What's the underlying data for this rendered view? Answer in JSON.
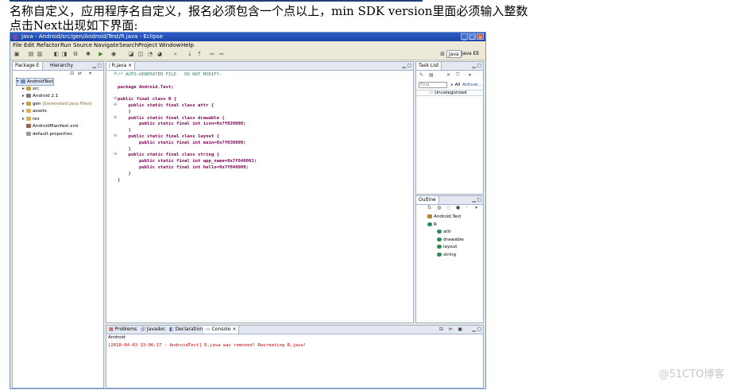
{
  "doc": {
    "line1": "名称自定义，应用程序名自定义，报名必须包含一个点以上，min SDK version里面必须输入整数",
    "line2": "点击Next出现如下界面:"
  },
  "window": {
    "title": "Java - Android/src/gen/Android/Test/R.java - Eclipse",
    "controls": {
      "min": "_",
      "max": "□",
      "close": "×"
    }
  },
  "menu": [
    "File",
    "Edit",
    "Refactor",
    "Run",
    "Source",
    "Navigate",
    "Search",
    "Project",
    "Window",
    "Help"
  ],
  "perspectives": {
    "java": "Java",
    "java_ee": "Java EE"
  },
  "package_explorer": {
    "tabs": [
      "Package E",
      "Hierarchy"
    ],
    "items": [
      {
        "label": "AndroidTest",
        "level": 0,
        "icon": "project-icon"
      },
      {
        "label": "src",
        "level": 1,
        "icon": "source-folder-icon"
      },
      {
        "label": "Android 2.1",
        "level": 1,
        "icon": "library-icon"
      },
      {
        "label": "gen",
        "note": "[Generated Java Files]",
        "level": 1,
        "icon": "source-folder-icon"
      },
      {
        "label": "assets",
        "level": 1,
        "icon": "folder-icon"
      },
      {
        "label": "res",
        "level": 1,
        "icon": "folder-icon"
      },
      {
        "label": "AndroidManifest.xml",
        "level": 1,
        "icon": "xml-file-icon"
      },
      {
        "label": "default.properties",
        "level": 1,
        "icon": "file-icon"
      }
    ]
  },
  "editor": {
    "tab": "R.java",
    "lines": [
      "/* AUTO-GENERATED FILE.  DO NOT MODIFY.",
      "",
      "package Android.Test;",
      "",
      "public final class R {",
      "    public static final class attr {",
      "    }",
      "    public static final class drawable {",
      "        public static final int icon=0x7f020000;",
      "    }",
      "    public static final class layout {",
      "        public static final int main=0x7f030000;",
      "    }",
      "    public static final class string {",
      "        public static final int app_name=0x7f040001;",
      "        public static final int hello=0x7f040000;",
      "    }",
      "}"
    ]
  },
  "task_list": {
    "tab": "Task List",
    "find_placeholder": "Find",
    "all_label": "All",
    "activate_label": "Activat...",
    "category": "Uncategorized"
  },
  "outline": {
    "tab": "Outline",
    "items": [
      {
        "label": "Android.Test",
        "level": 0,
        "icon": "package-icon"
      },
      {
        "label": "R",
        "level": 0,
        "icon": "class-icon"
      },
      {
        "label": "attr",
        "level": 1,
        "icon": "inner-class-icon"
      },
      {
        "label": "drawable",
        "level": 1,
        "icon": "inner-class-icon"
      },
      {
        "label": "layout",
        "level": 1,
        "icon": "inner-class-icon"
      },
      {
        "label": "string",
        "level": 1,
        "icon": "inner-class-icon"
      }
    ]
  },
  "bottom": {
    "tabs": [
      "Problems",
      "Javadoc",
      "Declaration",
      "Console"
    ],
    "console_title": "Android",
    "console_line": "[2010-04-03 13:06:17 - AndroidTest] R.java was removed! Recreating R.java!"
  },
  "watermark": "@51CTO博客",
  "colors": {
    "keyword": "#7f0055",
    "comment": "#3f7f5f",
    "console_error": "#d00000",
    "title_bar": "#2b5fc7"
  }
}
